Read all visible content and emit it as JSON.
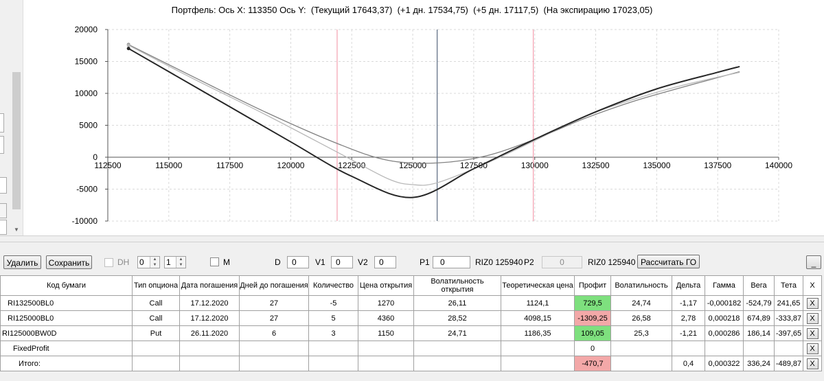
{
  "chart_title": "Портфель: Ось X: 113350 Ось Y:  (Текущий 17643,37)  (+1 дн. 17534,75)  (+5 дн. 17117,5)  (На экспирацию 17023,05)",
  "chart_data": {
    "type": "line",
    "xlim": [
      112500,
      140000
    ],
    "ylim": [
      -10000,
      20000
    ],
    "x_ticks": [
      112500,
      115000,
      117500,
      120000,
      122500,
      125000,
      127500,
      130000,
      132500,
      135000,
      137500,
      140000
    ],
    "x_tick_labels": [
      "112500",
      "115000",
      "117500",
      "120000",
      "122500",
      "125000",
      "127500",
      "130000",
      "132500",
      "135000",
      "137500",
      "140000"
    ],
    "y_ticks": [
      -10000,
      -5000,
      0,
      5000,
      10000,
      15000,
      20000
    ],
    "y_tick_labels": [
      "-10000",
      "-5000",
      "0",
      "5000",
      "10000",
      "15000",
      "20000"
    ],
    "grid": true,
    "vertical_markers": [
      {
        "x": 121900,
        "color": "#f4a0b0"
      },
      {
        "x": 126000,
        "color": "#5a6a80"
      },
      {
        "x": 129940,
        "color": "#f4a0b0"
      }
    ],
    "series": [
      {
        "color": "#808080",
        "x": [
          113350,
          116000,
          119000,
          122000,
          124000,
          126000,
          128000,
          130000,
          132000,
          134000,
          136000,
          138400
        ],
        "y": [
          17643,
          12600,
          7000,
          2000,
          -500,
          -900,
          200,
          2800,
          6000,
          8700,
          10900,
          13400
        ]
      },
      {
        "color": "#b8b8b8",
        "x": [
          113350,
          116000,
          119000,
          122000,
          124000,
          125000,
          126000,
          128000,
          130000,
          132000,
          134000,
          136000,
          138400
        ],
        "y": [
          17534,
          12300,
          6600,
          600,
          -3400,
          -4300,
          -4000,
          -1000,
          2600,
          6300,
          9000,
          11200,
          13300
        ]
      },
      {
        "color": "#262626",
        "x": [
          113350,
          115000,
          117500,
          120000,
          122500,
          125000,
          127500,
          130000,
          132500,
          135000,
          137500,
          138400
        ],
        "y": [
          17023,
          13400,
          7900,
          2400,
          -3000,
          -6300,
          -1800,
          2800,
          7100,
          10700,
          13300,
          14200
        ]
      }
    ]
  },
  "toolbar": {
    "delete_label": "Удалить",
    "save_label": "Сохранить",
    "dh_label": "DH",
    "dh_spin1": "0",
    "dh_spin2": "1",
    "m_label": "M",
    "d_label": "D",
    "d_value": "0",
    "v1_label": "V1",
    "v1_value": "0",
    "v2_label": "V2",
    "v2_value": "0",
    "p1_label": "P1",
    "p1_value": "0",
    "riz_label_1": "RIZ0 125940",
    "p2_label": "P2",
    "p2_value": "0",
    "riz_label_2": "RIZ0 125940",
    "calc_go_label": "Рассчитать ГО",
    "minimize_label": "_"
  },
  "table": {
    "headers": {
      "code": "Код бумаги",
      "type": "Тип опциона",
      "date": "Дата погашения",
      "days": "Дней до погашения",
      "qty": "Количество",
      "open_price": "Цена открытия",
      "open_vol": "Волатильность открытия",
      "theo": "Теоретическая цена",
      "profit": "Профит",
      "vol": "Волатильность",
      "delta": "Дельта",
      "gamma": "Гамма",
      "vega": "Вега",
      "theta": "Тета",
      "x": "X"
    },
    "rows": [
      {
        "code": "RI132500BL0",
        "type": "Call",
        "date": "17.12.2020",
        "days": "27",
        "qty": "-5",
        "open_price": "1270",
        "open_vol": "26,11",
        "theo": "1124,1",
        "profit": "729,5",
        "vol": "24,74",
        "delta": "-1,17",
        "gamma": "-0,000182",
        "vega": "-524,79",
        "theta": "241,65",
        "x": "X"
      },
      {
        "code": "RI125000BL0",
        "type": "Call",
        "date": "17.12.2020",
        "days": "27",
        "qty": "5",
        "open_price": "4360",
        "open_vol": "28,52",
        "theo": "4098,15",
        "profit": "-1309,25",
        "vol": "26,58",
        "delta": "2,78",
        "gamma": "0,000218",
        "vega": "674,89",
        "theta": "-333,87",
        "x": "X"
      },
      {
        "code": "RI125000BW0D",
        "type": "Put",
        "date": "26.11.2020",
        "days": "6",
        "qty": "3",
        "open_price": "1150",
        "open_vol": "24,71",
        "theo": "1186,35",
        "profit": "109,05",
        "vol": "25,3",
        "delta": "-1,21",
        "gamma": "0,000286",
        "vega": "186,14",
        "theta": "-397,65",
        "x": "X"
      }
    ],
    "fixed_profit": {
      "code": "FixedProfit",
      "profit": "0",
      "x": "X"
    },
    "total": {
      "code": "Итого:",
      "profit": "-470,7",
      "delta": "0,4",
      "gamma": "0,000322",
      "vega": "336,24",
      "theta": "-489,87",
      "x": "X"
    }
  }
}
